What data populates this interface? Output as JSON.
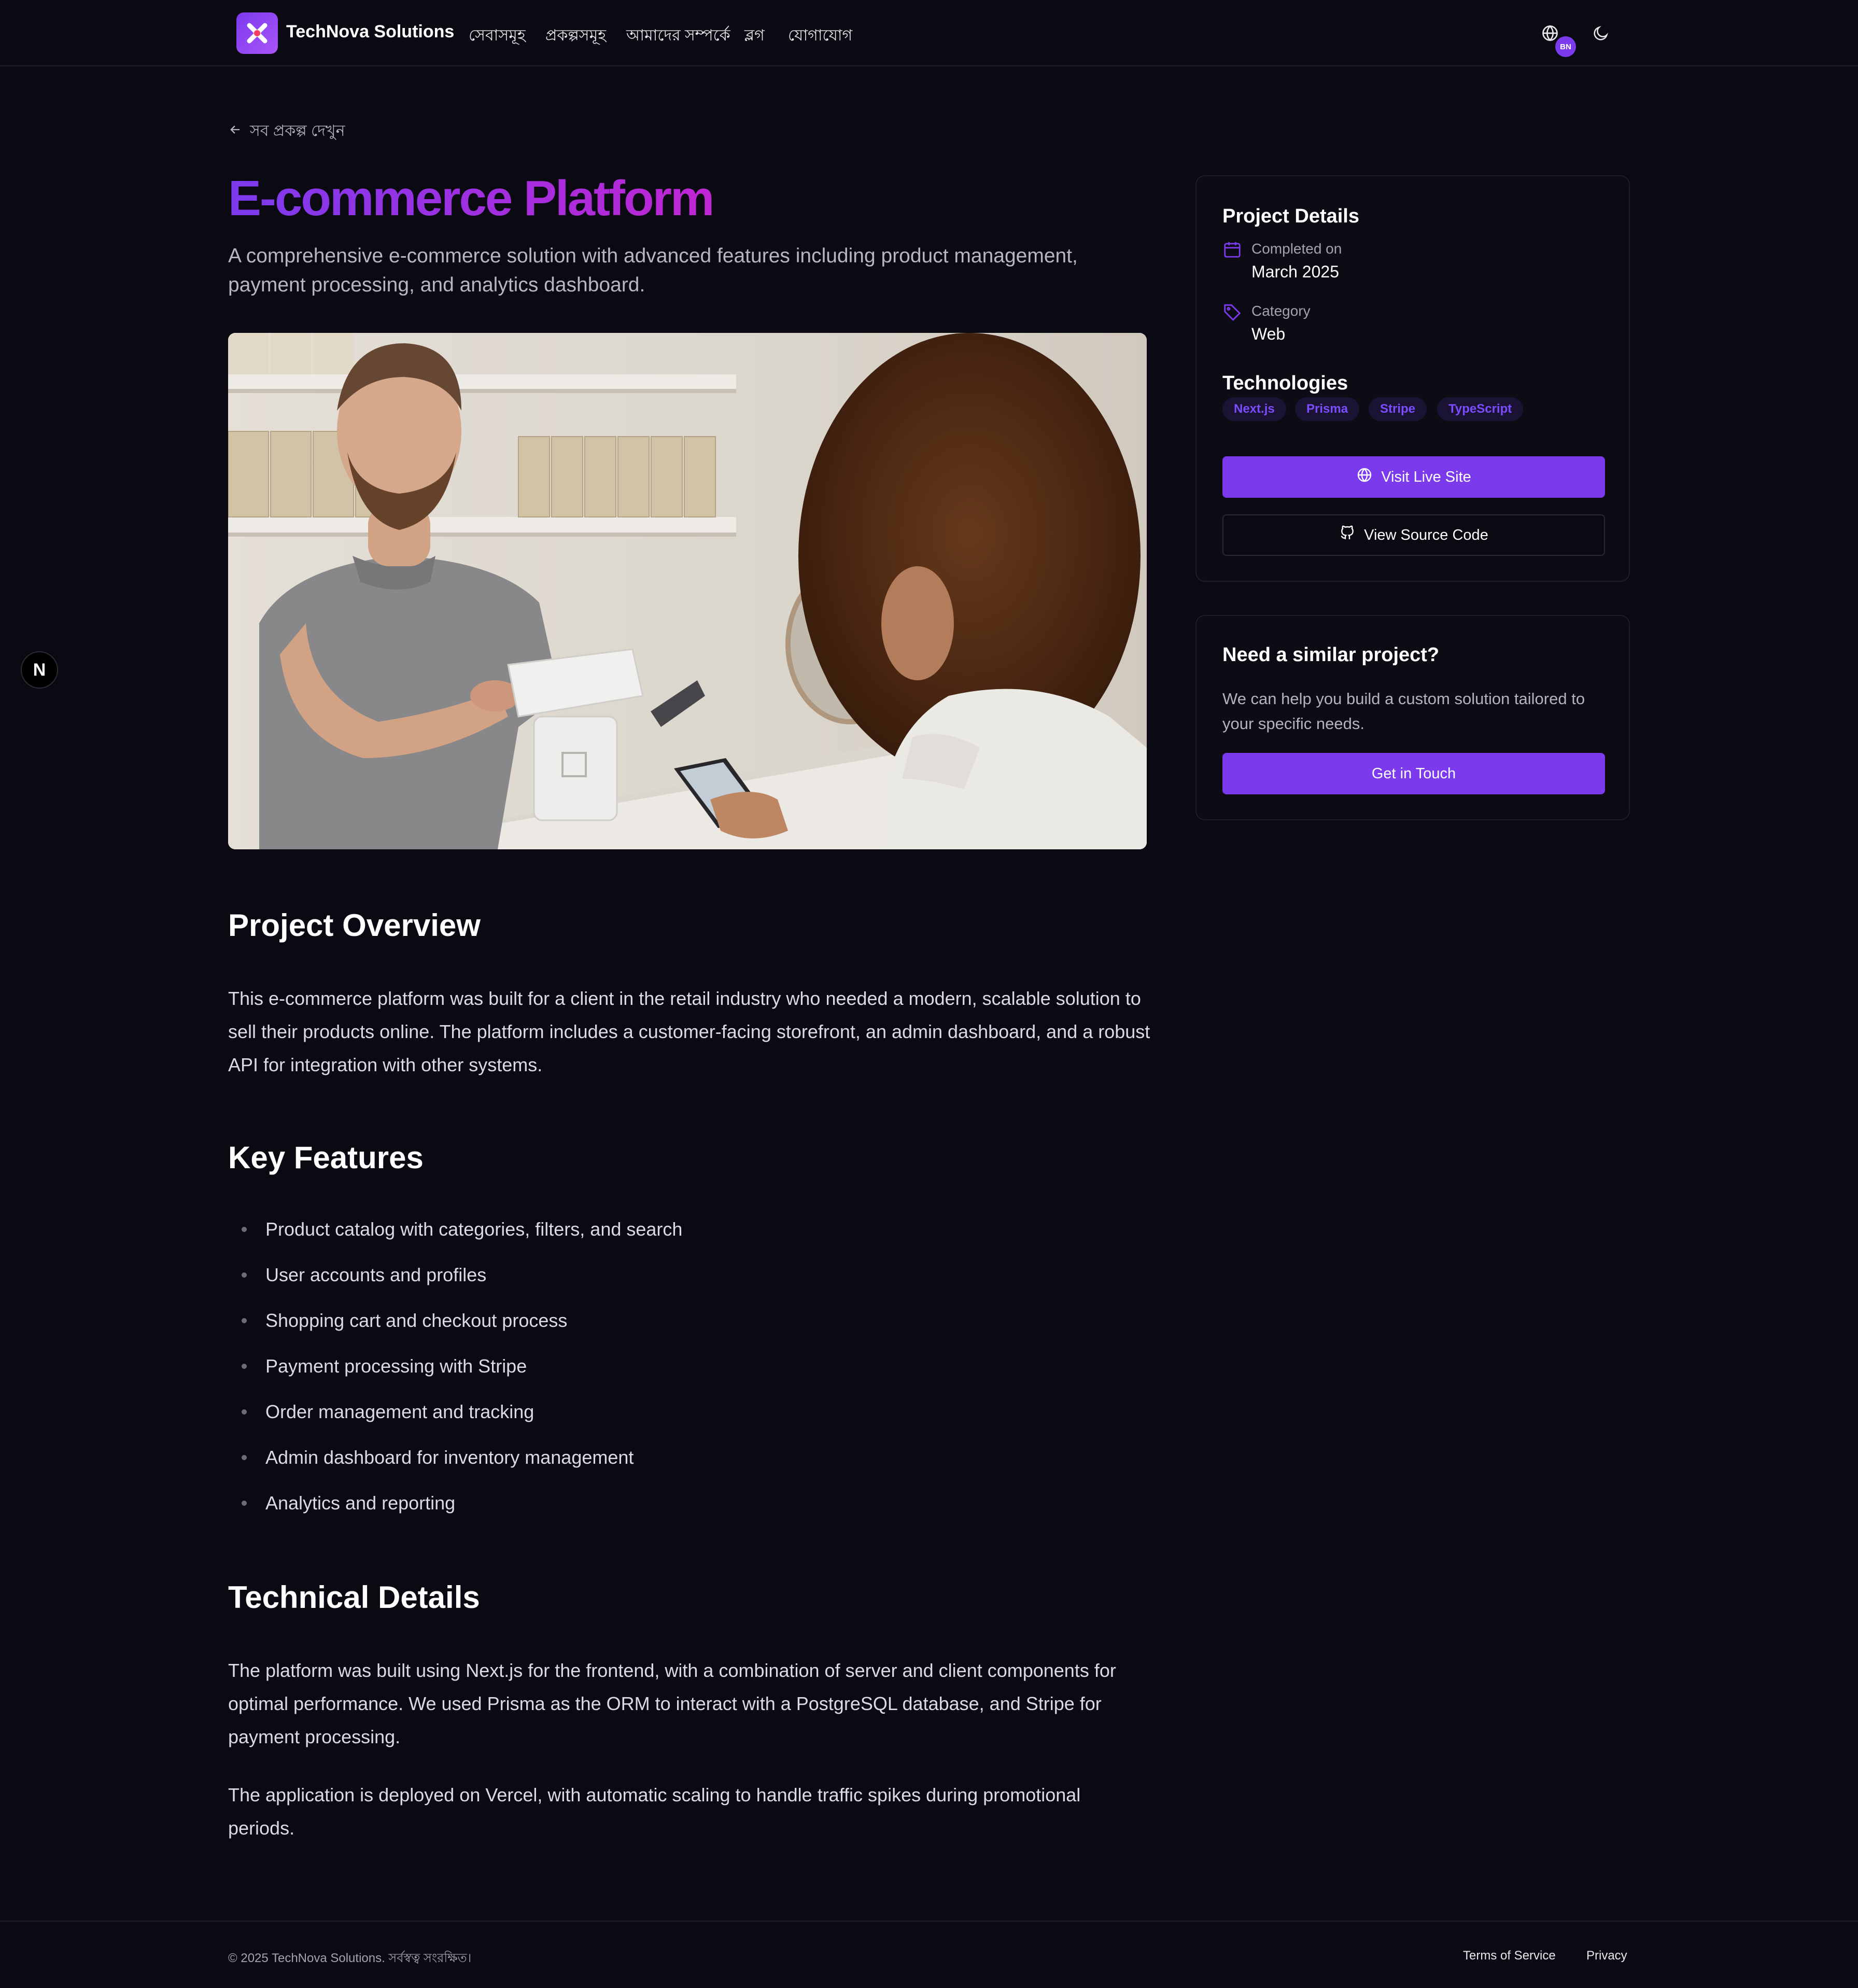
{
  "header": {
    "brand": "TechNova Solutions",
    "nav": [
      "সেবাসমূহ",
      "প্রকল্পসমূহ",
      "আমাদের সম্পর্কে",
      "ব্লগ",
      "যোগাযোগ"
    ],
    "lang_badge": "BN",
    "icons": [
      "logo-icon",
      "globe-icon",
      "moon-icon"
    ]
  },
  "back_link": "সব প্রকল্প দেখুন",
  "project": {
    "title": "E-commerce Platform",
    "subtitle": "A comprehensive e-commerce solution with advanced features including product management, payment processing, and analytics dashboard."
  },
  "overview": {
    "heading": "Project Overview",
    "text": "This e-commerce platform was built for a client in the retail industry who needed a modern, scalable solution to sell their products online. The platform includes a customer-facing storefront, an admin dashboard, and a robust API for integration with other systems."
  },
  "features": {
    "heading": "Key Features",
    "items": [
      "Product catalog with categories, filters, and search",
      "User accounts and profiles",
      "Shopping cart and checkout process",
      "Payment processing with Stripe",
      "Order management and tracking",
      "Admin dashboard for inventory management",
      "Analytics and reporting"
    ]
  },
  "technical": {
    "heading": "Technical Details",
    "paragraphs": [
      "The platform was built using Next.js for the frontend, with a combination of server and client components for optimal performance. We used Prisma as the ORM to interact with a PostgreSQL database, and Stripe for payment processing.",
      "The application is deployed on Vercel, with automatic scaling to handle traffic spikes during promotional periods."
    ]
  },
  "sidebar": {
    "details_heading": "Project Details",
    "completed_label": "Completed on",
    "completed_value": "March 2025",
    "category_label": "Category",
    "category_value": "Web",
    "tech_heading": "Technologies",
    "technologies": [
      "Next.js",
      "Prisma",
      "Stripe",
      "TypeScript"
    ],
    "visit_button": "Visit Live Site",
    "source_button": "View Source Code",
    "cta_heading": "Need a similar project?",
    "cta_text": "We can help you build a custom solution tailored to your specific needs.",
    "cta_button": "Get in Touch"
  },
  "floating_badge": "N",
  "footer": {
    "copyright": "© 2025 TechNova Solutions. সর্বস্বত্ব সংরক্ষিত।",
    "links": [
      "Terms of Service",
      "Privacy"
    ]
  },
  "colors": {
    "accent": "#7c3aed",
    "title_gradient_end": "#c026d3",
    "background": "#0b0a12"
  }
}
